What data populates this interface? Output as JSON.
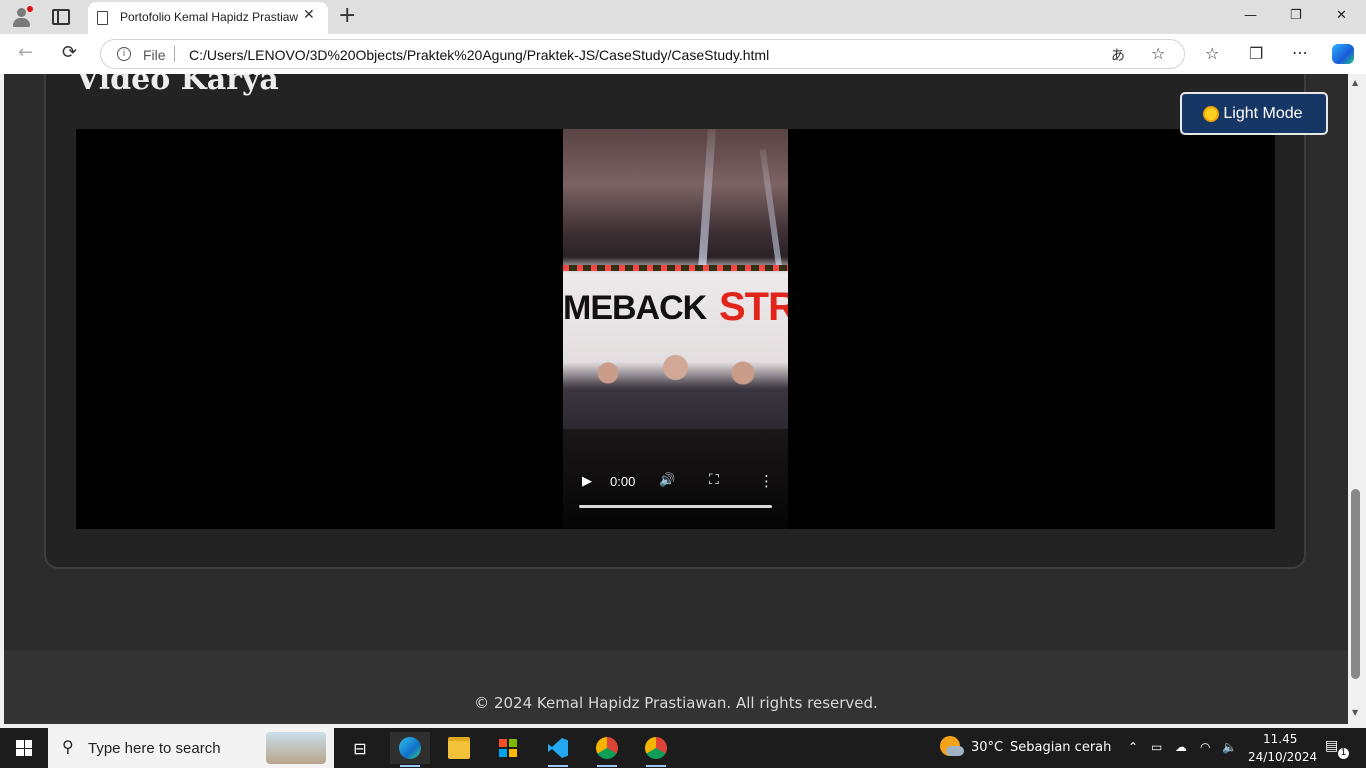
{
  "browser": {
    "tab_title": "Portofolio Kemal Hapidz Prastiawan",
    "tab_close": "✕",
    "new_tab": "+",
    "window_minimize": "—",
    "window_restore": "❐",
    "window_close": "✕",
    "back": "←",
    "reload": "⟳",
    "address_scheme": "File",
    "address_url": "C:/Users/LENOVO/3D%20Objects/Praktek%20Agung/Praktek-JS/CaseStudy/CaseStudy.html",
    "icons": [
      "read-aloud-icon",
      "favorite-star-icon",
      "favorites-icon",
      "collections-icon",
      "more-icon",
      "copilot-icon"
    ]
  },
  "page": {
    "section_title": "Video Karya",
    "mode_button_label": "Light Mode",
    "footer_text": "© 2024 Kemal Hapidz Prastiawan. All rights reserved.",
    "colors": {
      "page_bg": "#2c2c2c",
      "card_bg": "#232323",
      "mode_button_bg": "#163766",
      "footer_bg": "#333333"
    }
  },
  "video": {
    "banner_left": "MEBACK",
    "banner_right": "STRO",
    "play_icon": "▶",
    "time": "0:00",
    "volume_icon": "🔊",
    "fullscreen_icon": "⛶",
    "more_icon": "⋮",
    "progress": 0
  },
  "taskbar": {
    "search_placeholder": "Type here to search",
    "temperature": "30°C",
    "weather": "Sebagian cerah",
    "time": "11.45",
    "date": "24/10/2024",
    "notifications": "1",
    "apps": [
      "task-view",
      "edge",
      "file-explorer",
      "microsoft-store",
      "vscode",
      "chrome",
      "chrome-profile"
    ]
  }
}
